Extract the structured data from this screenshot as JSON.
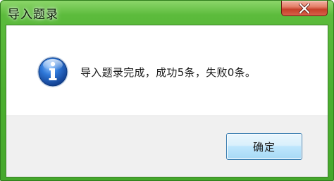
{
  "window": {
    "title": "导入题录",
    "close_icon": "close-icon"
  },
  "dialog": {
    "icon": "info-icon",
    "message": "导入题录完成，成功5条，失败0条。",
    "ok_label": "确定"
  },
  "colors": {
    "titlebar": "#4caf30",
    "close_button": "#c6402a",
    "footer": "#f0f0f0",
    "button_border": "#3c7fb1",
    "icon_blue": "#1f5fb8"
  }
}
